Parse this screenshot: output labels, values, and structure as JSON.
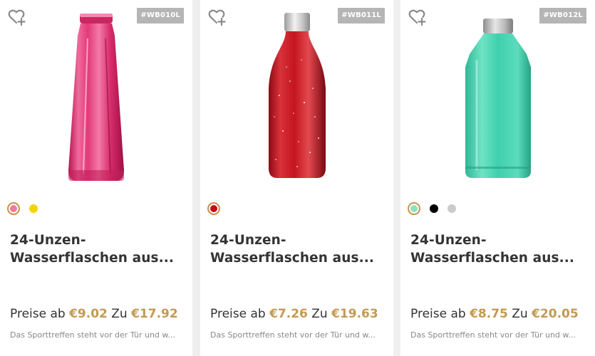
{
  "products": [
    {
      "sku": "#WB010L",
      "title_line1": "24-Unzen-",
      "title_line2": "Wasserflaschen aus...",
      "price_prefix": "Preise ab",
      "price_from": "€9.02",
      "price_mid": "Zu",
      "price_to": "€17.92",
      "description": "Das Sporttreffen steht vor der Tür und w...",
      "swatches": [
        "#f07aa0",
        "#f4d400"
      ],
      "selected_swatch": 0
    },
    {
      "sku": "#WB011L",
      "title_line1": "24-Unzen-",
      "title_line2": "Wasserflaschen aus...",
      "price_prefix": "Preise ab",
      "price_from": "€7.26",
      "price_mid": "Zu",
      "price_to": "€19.63",
      "description": "Das Sporttreffen steht vor der Tür und w...",
      "swatches": [
        "#c0101f"
      ],
      "selected_swatch": 0
    },
    {
      "sku": "#WB012L",
      "title_line1": "24-Unzen-",
      "title_line2": "Wasserflaschen aus...",
      "price_prefix": "Preise ab",
      "price_from": "€8.75",
      "price_mid": "Zu",
      "price_to": "€20.05",
      "description": "Das Sporttreffen steht vor der Tür und w...",
      "swatches": [
        "#8be0c6",
        "#000000",
        "#cccccc"
      ],
      "selected_swatch": 0
    }
  ],
  "colors": {
    "price_accent": "#c29a52",
    "swatch_ring": "#c8954d",
    "sku_badge": "#b5b5b5"
  },
  "icons": {
    "favorite": "heart-plus-icon"
  }
}
